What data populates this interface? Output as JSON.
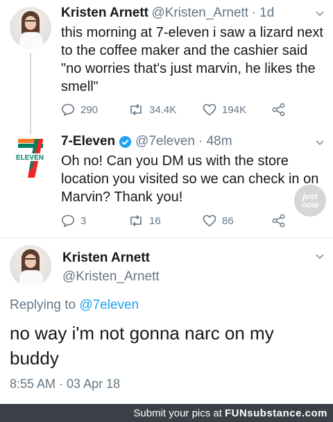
{
  "tweet1": {
    "name": "Kristen Arnett",
    "handle": "@Kristen_Arnett",
    "time": "· 1d",
    "text_lines": [
      "this morning at 7-eleven i saw a lizard next",
      "to the coffee maker and the cashier said",
      "\"no worries that's just marvin, he likes the",
      "smell\""
    ],
    "replies": "290",
    "retweets": "34.4K",
    "likes": "194K"
  },
  "tweet2": {
    "name": "7-Eleven",
    "handle": "@7eleven",
    "time": "· 48m",
    "logo_text": "ELEVEN",
    "text_lines": [
      "Oh no! Can you DM us with the store",
      "location you visited so we can check in on",
      "Marvin? Thank you!"
    ],
    "replies": "3",
    "retweets": "16",
    "likes": "86"
  },
  "tweet3": {
    "name": "Kristen Arnett",
    "handle": "@Kristen_Arnett",
    "replying_prefix": "Replying to ",
    "replying_handle": "@7eleven",
    "text_lines": [
      "no way i'm not gonna narc on my",
      "buddy"
    ],
    "timestamp": "8:55 AM · 03 Apr 18"
  },
  "watermark": {
    "line1": "just",
    "line2": "now"
  },
  "footer": {
    "prefix": "Submit your pics at",
    "brand": "FUNsubstance.com"
  },
  "colors": {
    "link_blue": "#1da1f2",
    "gray": "#657786",
    "verified": "#1da1f2",
    "seven_orange": "#f47b20",
    "seven_green": "#008163",
    "seven_red": "#ee2526",
    "footer_bg": "#3a4046"
  }
}
